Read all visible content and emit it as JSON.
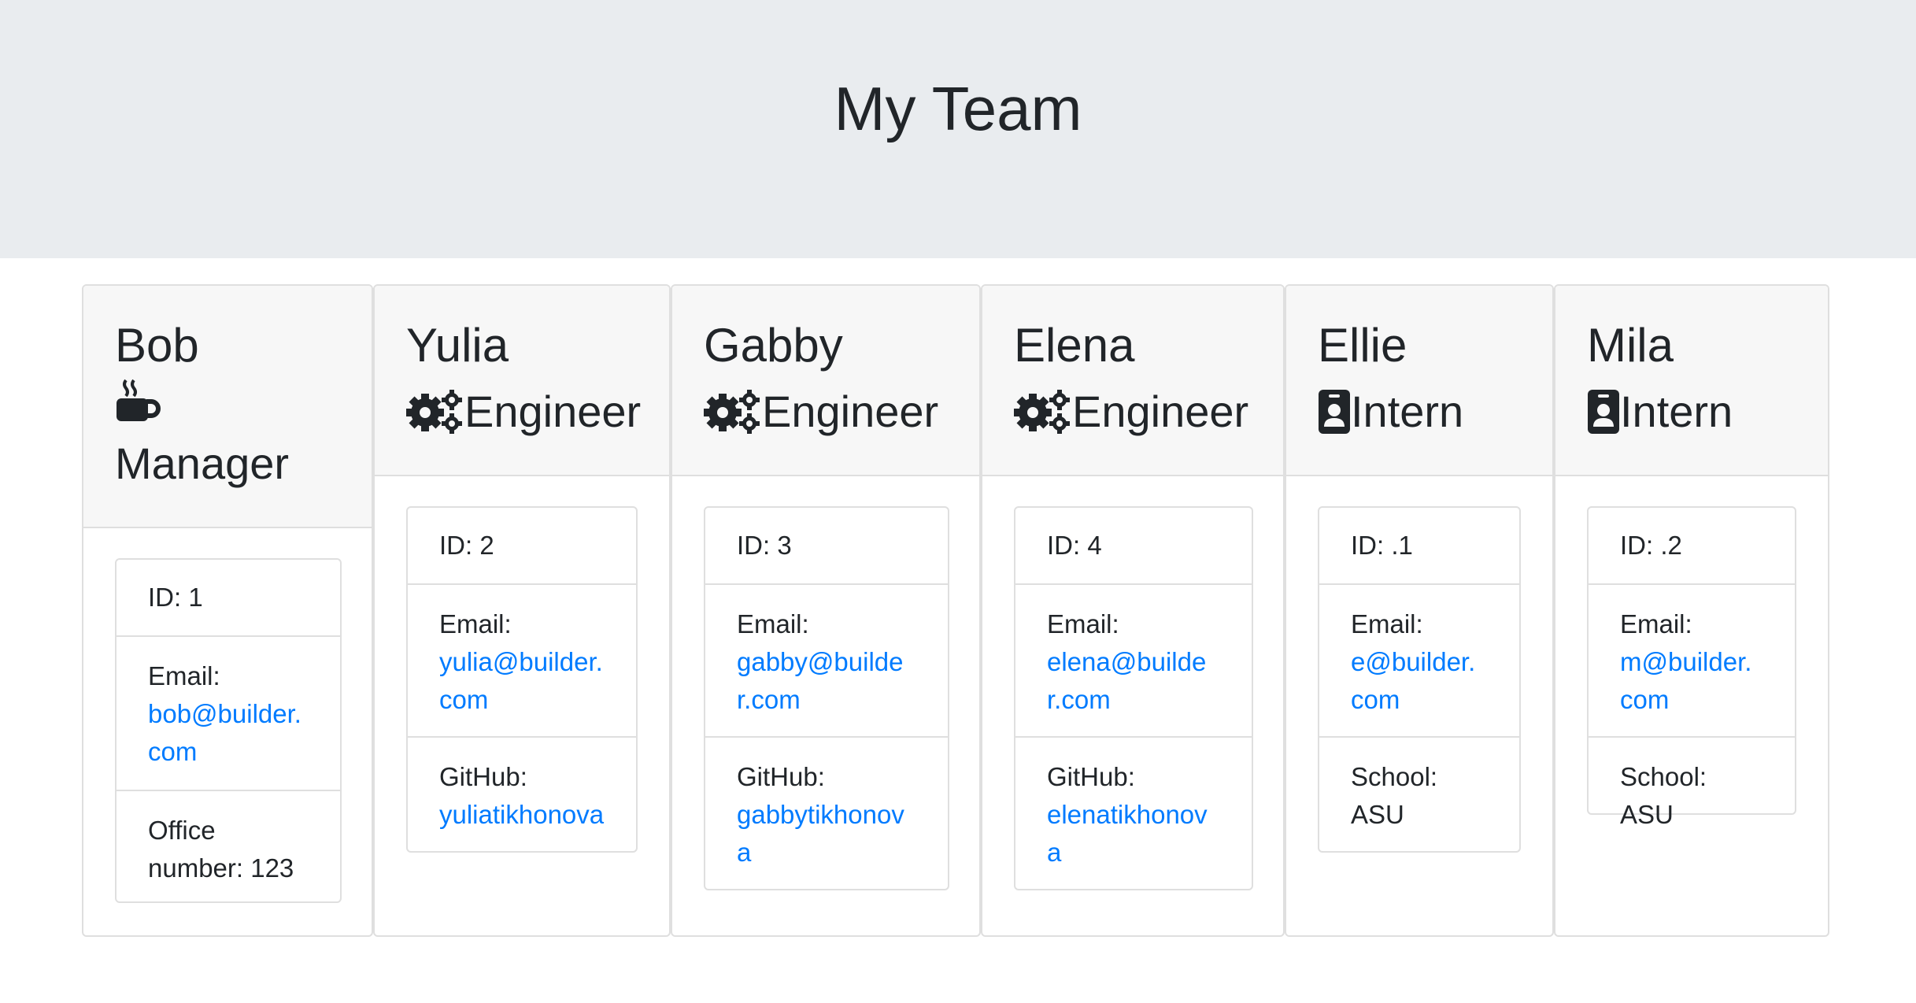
{
  "header": {
    "title": "My Team"
  },
  "members": [
    {
      "name": "Bob",
      "role": "Manager",
      "icon": "coffee-icon",
      "id_label": "ID: 1",
      "email_label": "Email:",
      "email": "bob@builder.com",
      "extra_label": "Office number: 123",
      "extra_value": ""
    },
    {
      "name": "Yulia",
      "role": "Engineer",
      "icon": "cogs-icon",
      "id_label": "ID: 2",
      "email_label": "Email:",
      "email": "yulia@builder.com",
      "extra_label": "GitHub:",
      "extra_value": "yuliatikhonova"
    },
    {
      "name": "Gabby",
      "role": "Engineer",
      "icon": "cogs-icon",
      "id_label": "ID: 3",
      "email_label": "Email:",
      "email": "gabby@builder.com",
      "extra_label": "GitHub:",
      "extra_value": "gabbytikhonova"
    },
    {
      "name": "Elena",
      "role": "Engineer",
      "icon": "cogs-icon",
      "id_label": "ID: 4",
      "email_label": "Email:",
      "email": "elena@builder.com",
      "extra_label": "GitHub:",
      "extra_value": "elenatikhonova"
    },
    {
      "name": "Ellie",
      "role": "Intern",
      "icon": "id-badge-icon",
      "id_label": "ID: .1",
      "email_label": "Email:",
      "email": "e@builder.com",
      "extra_label": "School: ASU",
      "extra_value": ""
    },
    {
      "name": "Mila",
      "role": "Intern",
      "icon": "id-badge-icon",
      "id_label": "ID: .2",
      "email_label": "Email:",
      "email": "m@builder.com",
      "extra_label": "School: ASU",
      "extra_value": ""
    }
  ],
  "colors": {
    "link": "#007bff",
    "header_bg": "#e9ecef",
    "card_header_bg": "#f7f7f7"
  }
}
